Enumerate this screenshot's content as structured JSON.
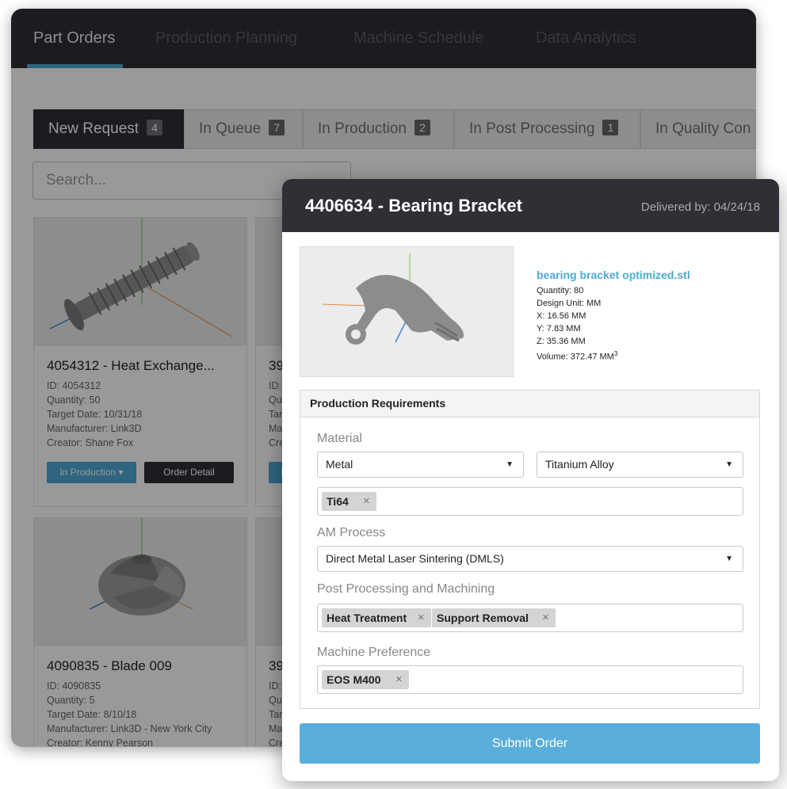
{
  "nav": {
    "tabs": [
      {
        "label": "Part Orders"
      },
      {
        "label": "Production Planning"
      },
      {
        "label": "Machine Schedule"
      },
      {
        "label": "Data Analytics"
      }
    ]
  },
  "status_tabs": [
    {
      "label": "New Request",
      "count": "4"
    },
    {
      "label": "In Queue",
      "count": "7"
    },
    {
      "label": "In Production",
      "count": "2"
    },
    {
      "label": "In Post Processing",
      "count": "1"
    },
    {
      "label": "In Quality Con"
    }
  ],
  "search": {
    "placeholder": "Search..."
  },
  "cards": [
    {
      "title": "4054312 - Heat Exchange...",
      "id": "ID: 4054312",
      "quantity": "Quantity: 50",
      "target_date": "Target Date: 10/31/18",
      "manufacturer": "Manufacturer: Link3D",
      "creator": "Creator: Shane Fox",
      "status_button": "In Production ▾",
      "detail_button": "Order Detail"
    },
    {
      "title": "39",
      "id": "ID:",
      "quantity": "Qu",
      "target_date": "Tar",
      "manufacturer": "Ma",
      "creator": "Cre",
      "status_button": "In",
      "detail_button": ""
    },
    {
      "title": "4090835 - Blade 009",
      "id": "ID: 4090835",
      "quantity": "Quantity: 5",
      "target_date": "Target Date: 8/10/18",
      "manufacturer": "Manufacturer: Link3D - New York City",
      "creator": "Creator: Kenny Pearson"
    },
    {
      "title": "39",
      "id": "ID:",
      "quantity": "Qu",
      "target_date": "Tar",
      "manufacturer": "Ma",
      "creator": "Cre"
    }
  ],
  "modal": {
    "title": "4406634 - Bearing Bracket",
    "delivered": "Delivered by: 04/24/18",
    "file": {
      "name": "bearing bracket optimized.stl",
      "quantity": "Quantity: 80",
      "design_unit": "Design Unit: MM",
      "x": "X: 16.56 MM",
      "y": "Y: 7.83 MM",
      "z": "Z: 35.36 MM",
      "volume": "Volume: 372.47 MM",
      "volume_exp": "3"
    },
    "requirements": {
      "heading": "Production Requirements",
      "material_label": "Material",
      "material_type": "Metal",
      "material_alloy": "Titanium Alloy",
      "material_tags": [
        "Ti64"
      ],
      "process_label": "AM Process",
      "process_value": "Direct Metal Laser Sintering (DMLS)",
      "post_label": "Post Processing and Machining",
      "post_tags": [
        "Heat Treatment",
        "Support Removal"
      ],
      "machine_label": "Machine Preference",
      "machine_tags": [
        "EOS M400"
      ]
    },
    "submit": "Submit Order"
  },
  "icons": {
    "caret": "caret-down-icon",
    "remove": "close-icon"
  },
  "colors": {
    "accent": "#4da9d6",
    "nav_bg": "#2e3036",
    "submit": "#5aaedb"
  }
}
